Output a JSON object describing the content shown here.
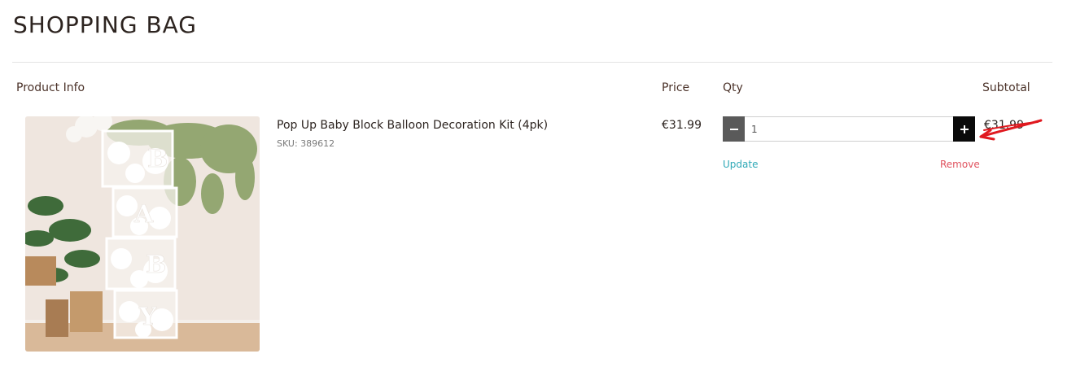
{
  "page": {
    "title": "SHOPPING BAG"
  },
  "table_headers": {
    "product_info": "Product Info",
    "price": "Price",
    "qty": "Qty",
    "subtotal": "Subtotal"
  },
  "item": {
    "name": "Pop Up Baby Block Balloon Decoration Kit (4pk)",
    "sku": "SKU: 389612",
    "price": "€31.99",
    "qty_value": "1",
    "subtotal": "€31.99",
    "update_label": "Update",
    "remove_label": "Remove",
    "image_letters": [
      "B",
      "A",
      "B",
      "Y"
    ]
  },
  "colors": {
    "update_link": "#2fa9b7",
    "remove_link": "#e0535f",
    "annotation_stroke": "#e0191f"
  },
  "icons": {
    "minus": "minus-icon",
    "plus": "plus-icon"
  }
}
